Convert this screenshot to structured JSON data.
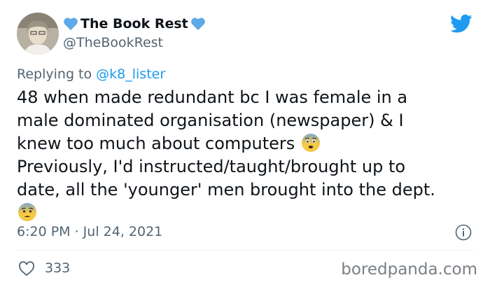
{
  "tweet": {
    "display_name": "The Book Rest",
    "handle": "@TheBookRest",
    "reply_prefix": "Replying to ",
    "reply_mention": "@k8_lister",
    "text_line1": "48 when made redundant bc I was female in a\nmale dominated organisation (newspaper) & I\nknew too much about computers ",
    "text_line2": "\nPreviously, I'd instructed/taught/brought up to\ndate, all the 'younger' men brought into the dept.\n",
    "timestamp": "6:20 PM · Jul 24, 2021",
    "like_count": "333"
  },
  "watermark": "boredpanda.com",
  "icons": {
    "heart_color": "#5da9e9",
    "bird_color": "#1d9bf0",
    "emoji_1": "fearful-face",
    "emoji_2": "anxious-face-with-sweat"
  }
}
